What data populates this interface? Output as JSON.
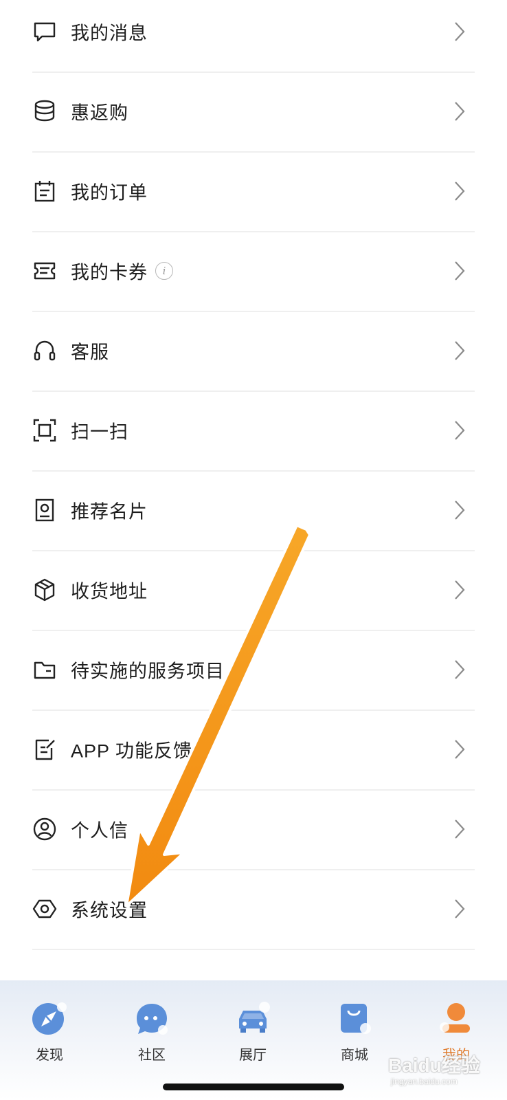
{
  "menu": {
    "items": [
      {
        "label": "我的消息",
        "icon": "message-icon"
      },
      {
        "label": "惠返购",
        "icon": "coins-icon"
      },
      {
        "label": "我的订单",
        "icon": "order-icon"
      },
      {
        "label": "我的卡券",
        "icon": "coupon-icon",
        "badge": "i"
      },
      {
        "label": "客服",
        "icon": "headset-icon"
      },
      {
        "label": "扫一扫",
        "icon": "scan-icon"
      },
      {
        "label": "推荐名片",
        "icon": "card-icon"
      },
      {
        "label": "收货地址",
        "icon": "box-icon"
      },
      {
        "label": "待实施的服务项目",
        "icon": "folder-icon"
      },
      {
        "label": "APP 功能反馈",
        "icon": "feedback-icon"
      },
      {
        "label": "个人信",
        "icon": "user-circle-icon"
      },
      {
        "label": "系统设置",
        "icon": "settings-icon"
      }
    ]
  },
  "tabbar": {
    "tabs": [
      {
        "label": "发现",
        "icon": "compass-icon"
      },
      {
        "label": "社区",
        "icon": "chat-bubble-icon"
      },
      {
        "label": "展厅",
        "icon": "car-icon"
      },
      {
        "label": "商城",
        "icon": "shopping-bag-icon"
      },
      {
        "label": "我的",
        "icon": "person-icon",
        "active": true
      }
    ]
  },
  "watermark": {
    "main": "Baidu经验",
    "sub": "jingyan.baidu.com"
  },
  "colors": {
    "accent": "#e07a2a",
    "arrow": "#f59a1c",
    "tab_blue": "#5b8fd9"
  }
}
